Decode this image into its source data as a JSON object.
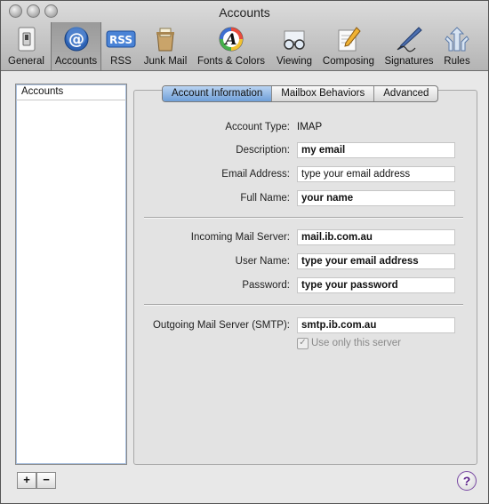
{
  "window": {
    "title": "Accounts"
  },
  "toolbar": {
    "items": [
      {
        "label": "General",
        "icon": "light-switch-icon"
      },
      {
        "label": "Accounts",
        "icon": "at-sign-icon",
        "selected": true
      },
      {
        "label": "RSS",
        "icon": "rss-icon",
        "icon_text": "RSS"
      },
      {
        "label": "Junk Mail",
        "icon": "junk-mail-bin-icon"
      },
      {
        "label": "Fonts & Colors",
        "icon": "font-palette-icon",
        "icon_text": "A"
      },
      {
        "label": "Viewing",
        "icon": "glasses-icon"
      },
      {
        "label": "Composing",
        "icon": "pencil-paper-icon"
      },
      {
        "label": "Signatures",
        "icon": "signature-pen-icon"
      },
      {
        "label": "Rules",
        "icon": "rules-arrows-icon"
      }
    ]
  },
  "sidebar": {
    "header": "Accounts",
    "add_label": "+",
    "remove_label": "−"
  },
  "tabs": [
    {
      "label": "Account Information",
      "active": true
    },
    {
      "label": "Mailbox Behaviors",
      "active": false
    },
    {
      "label": "Advanced",
      "active": false
    }
  ],
  "form": {
    "account_type": {
      "label": "Account Type:",
      "value": "IMAP"
    },
    "description": {
      "label": "Description:",
      "value": "my email"
    },
    "email_address": {
      "label": "Email Address:",
      "value": "type your email address"
    },
    "full_name": {
      "label": "Full Name:",
      "value": "your name"
    },
    "incoming_server": {
      "label": "Incoming Mail Server:",
      "value": "mail.ib.com.au"
    },
    "user_name": {
      "label": "User Name:",
      "value": "type your email address"
    },
    "password": {
      "label": "Password:",
      "value": "type your password"
    },
    "outgoing_server": {
      "label": "Outgoing Mail Server (SMTP):",
      "value": "smtp.ib.com.au"
    },
    "use_only_server": {
      "label": "Use only this server",
      "checked": true
    }
  },
  "help": {
    "label": "?"
  }
}
